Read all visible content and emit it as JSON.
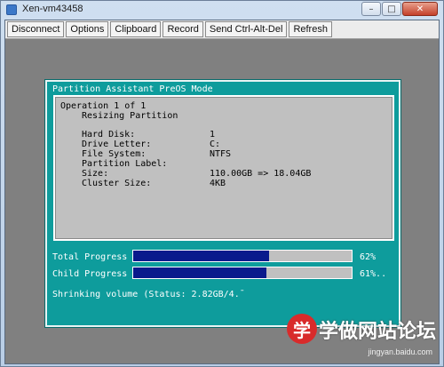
{
  "window": {
    "title": "Xen-vm43458",
    "buttons": {
      "minimize": "–",
      "maximize": "□",
      "close": "✕"
    }
  },
  "toolbar": [
    "Disconnect",
    "Options",
    "Clipboard",
    "Record",
    "Send Ctrl-Alt-Del",
    "Refresh"
  ],
  "preos": {
    "panel_title": "Partition Assistant PreOS Mode",
    "operation": "Operation 1 of 1",
    "action": "Resizing Partition",
    "details": [
      {
        "label": "Hard Disk:",
        "value": "1"
      },
      {
        "label": "Drive Letter:",
        "value": "C:"
      },
      {
        "label": "File System:",
        "value": "NTFS"
      },
      {
        "label": "Partition Label:",
        "value": ""
      },
      {
        "label": "Size:",
        "value": "110.00GB => 18.04GB"
      },
      {
        "label": "Cluster Size:",
        "value": "4KB"
      }
    ],
    "total_progress": {
      "label": "Total Progress",
      "value": 62,
      "text": "62%"
    },
    "child_progress": {
      "label": "Child Progress",
      "value": 61,
      "text": "61%.."
    },
    "status": "Shrinking volume (Status: 2.82GB/4.¯"
  },
  "watermark": {
    "logo_char": "学",
    "text": "学做网站论坛",
    "url": "jingyan.baidu.com"
  },
  "colors": {
    "panel_bg": "#0e9c9c",
    "progress_fill": "#0a1a8c",
    "info_bg": "#c0c0c0"
  }
}
